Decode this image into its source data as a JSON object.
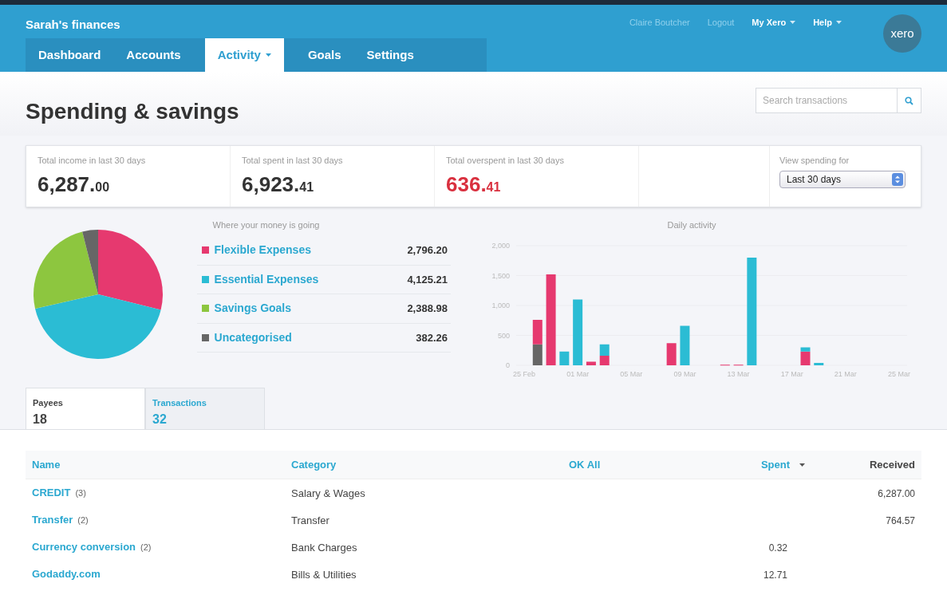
{
  "header": {
    "title": "Sarah's finances",
    "user": "Claire Boutcher",
    "links": [
      {
        "label": "Logout",
        "kind": "plain"
      },
      {
        "label": "My Xero",
        "kind": "menu"
      },
      {
        "label": "Help",
        "kind": "menu"
      }
    ],
    "logo": "xero"
  },
  "nav_tabs": [
    {
      "label": "Dashboard",
      "selected": false,
      "has_menu": false
    },
    {
      "label": "Accounts",
      "selected": false,
      "has_menu": false
    },
    {
      "label": "Activity",
      "selected": true,
      "has_menu": true
    },
    {
      "label": "Goals",
      "selected": false,
      "has_menu": false
    },
    {
      "label": "Settings",
      "selected": false,
      "has_menu": false
    }
  ],
  "page_title": "Spending & savings",
  "search": {
    "placeholder": "Search transactions"
  },
  "summary": [
    {
      "label": "Total income in last 30 days",
      "whole": "6,287.",
      "cents": "00",
      "kind": "normal"
    },
    {
      "label": "Total spent in last 30 days",
      "whole": "6,923.",
      "cents": "41",
      "kind": "normal"
    },
    {
      "label": "Total overspent in last 30 days",
      "whole": "636.",
      "cents": "41",
      "kind": "alert"
    }
  ],
  "period": {
    "label": "View spending for",
    "value": "Last 30 days"
  },
  "breakdown": {
    "title": "Where your money is going",
    "items": [
      {
        "amount": "2,796.20",
        "color": "#e6396f"
      },
      {
        "amount": "4,125.21",
        "color": "#2bbcd4"
      },
      {
        "amount": "2,388.98",
        "color": "#8dc63f"
      },
      {
        "amount": "382.26",
        "color": "#666666"
      }
    ],
    "chart_data": {
      "type": "pie",
      "categories": [
        "Flexible Expenses",
        "Essential Expenses",
        "Savings Goals",
        "Uncategorised"
      ],
      "values": [
        28.85,
        42.56,
        24.65,
        3.94
      ]
    }
  },
  "daily": {
    "chart_data": {
      "type": "bar",
      "title": "Daily activity",
      "stacked": true,
      "categories": [
        "25 Feb",
        null,
        null,
        null,
        "01 Mar",
        null,
        null,
        null,
        "05 Mar",
        null,
        null,
        null,
        "09 Mar",
        null,
        null,
        null,
        "13 Mar",
        null,
        null,
        null,
        "17 Mar",
        null,
        null,
        null,
        "21 Mar",
        null,
        null,
        null,
        "25 Mar"
      ],
      "series": [
        {
          "color": "#666666",
          "values": [
            null,
            350,
            null,
            null,
            null,
            null,
            null,
            null,
            null,
            null,
            null,
            null,
            null,
            null,
            null,
            null,
            null,
            null,
            null,
            null,
            null,
            null,
            null,
            null,
            null,
            null,
            null,
            null,
            null
          ]
        },
        {
          "color": "#e6396f",
          "values": [
            null,
            410,
            1520,
            null,
            null,
            60,
            160,
            null,
            null,
            null,
            null,
            370,
            null,
            null,
            null,
            10,
            10,
            null,
            null,
            null,
            null,
            230,
            null,
            null,
            null,
            null,
            null,
            null,
            null
          ]
        },
        {
          "color": "#2bbcd4",
          "values": [
            null,
            null,
            null,
            230,
            1100,
            null,
            190,
            null,
            null,
            null,
            null,
            null,
            660,
            null,
            null,
            null,
            null,
            1800,
            null,
            null,
            null,
            70,
            40,
            null,
            null,
            null,
            null,
            null,
            null
          ]
        }
      ],
      "ylim": [
        0,
        2000
      ],
      "yticks": [
        0,
        {
          "value": 500,
          "label": "500"
        },
        {
          "value": 1000,
          "label": "1,000"
        },
        {
          "value": 1500,
          "label": "1,500"
        },
        {
          "value": 2000,
          "label": "2,000"
        }
      ]
    }
  },
  "list_tabs": [
    {
      "label": "Payees",
      "count": "18",
      "selected": true
    },
    {
      "label": "Transactions",
      "count": "32",
      "selected": false
    }
  ],
  "table": {
    "columns": [
      {
        "label": "Name",
        "kind": "link"
      },
      {
        "label": "Category",
        "kind": "link"
      },
      {
        "label": "OK All",
        "kind": "button"
      },
      {
        "label": "Spent",
        "kind": "sort"
      },
      {
        "label": "Received",
        "kind": "plain"
      }
    ],
    "rows": [
      {
        "name": "CREDIT",
        "count": "(3)",
        "category": "Salary & Wages",
        "received": "6,287.00"
      },
      {
        "name": "Transfer",
        "count": "(2)",
        "category": "Transfer",
        "received": "764.57"
      },
      {
        "name": "Currency conversion",
        "count": "(2)",
        "category": "Bank Charges",
        "spent": "0.32"
      },
      {
        "name": "Godaddy.com",
        "category": "Bills & Utilities",
        "spent": "12.71"
      }
    ]
  }
}
